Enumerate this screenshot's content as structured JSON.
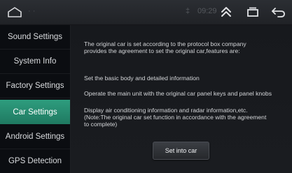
{
  "statusbar": {
    "home_icon": "home-outline-icon",
    "faint_indicator": "· ·",
    "signal_text": "‡",
    "time_text": "09:29",
    "actions": [
      {
        "icon": "double-chevron-up-icon"
      },
      {
        "icon": "recent-apps-icon"
      },
      {
        "icon": "back-arrow-icon"
      }
    ]
  },
  "sidebar": {
    "items": [
      {
        "label": "Sound Settings",
        "active": false
      },
      {
        "label": "System Info",
        "active": false
      },
      {
        "label": "Factory Settings",
        "active": false
      },
      {
        "label": "Car Settings",
        "active": true
      },
      {
        "label": "Android Settings",
        "active": false
      },
      {
        "label": "GPS Detection",
        "active": false
      }
    ]
  },
  "content": {
    "intro_line1": "The original car is set according to the protocol box company",
    "intro_line2": "provides the agreement to set the original car,features are:",
    "feature1": "Set the basic body and detailed information",
    "feature2": "Operate the main unit with the original car panel keys and panel knobs",
    "feature3_line1": "Display air conditioning information and radar information,etc.",
    "feature3_line2": "(Note:The original car set function in accordance with the agreement",
    "feature3_line3": "to complete)",
    "set_button_label": "Set into car"
  },
  "colors": {
    "accent": "#2a8f73",
    "background": "#0b0d11",
    "panel": "#181a1e",
    "text": "#d4d6d9"
  }
}
